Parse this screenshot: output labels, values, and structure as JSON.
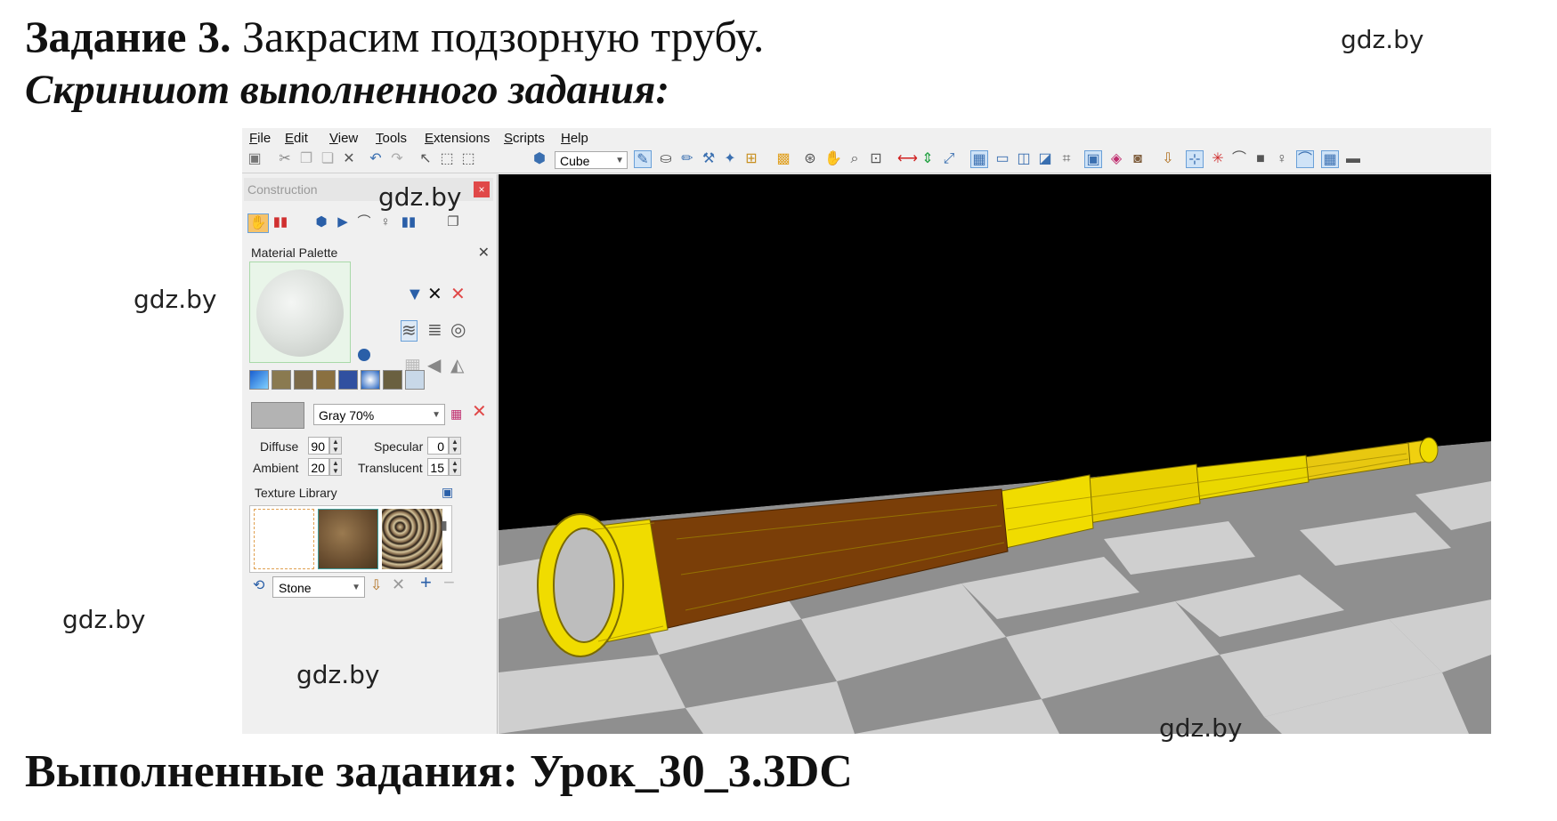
{
  "header": {
    "task_bold": "Задание 3.",
    "task_rest": " Закрасим подзорную трубу.",
    "subtitle": "Скриншот выполненного задания:",
    "footer": "Выполненные задания: Урок_30_3.3DC"
  },
  "watermark": "gdz.by",
  "app": {
    "menu": [
      "File",
      "Edit",
      "View",
      "Tools",
      "Extensions",
      "Scripts",
      "Help"
    ],
    "toolbar": {
      "shape_select": "Cube"
    },
    "panel": {
      "title": "Construction",
      "close_glyph": "×",
      "material_palette": {
        "title": "Material Palette",
        "close_glyph": "✕",
        "material_select": "Gray 70%",
        "diffuse_label": "Diffuse",
        "diffuse_value": "90",
        "specular_label": "Specular",
        "specular_value": "0",
        "ambient_label": "Ambient",
        "ambient_value": "20",
        "translucent_label": "Translucent",
        "translucent_value": "15"
      },
      "texture_library": {
        "title": "Texture Library",
        "select": "Stone",
        "add_glyph": "+",
        "remove_glyph": "−"
      }
    }
  },
  "colors": {
    "viewport_bg": "#000000",
    "telescope_gold": "#e8d000",
    "telescope_brown": "#7a3e08",
    "accent_blue": "#3a6fb0",
    "close_red": "#e04848"
  }
}
